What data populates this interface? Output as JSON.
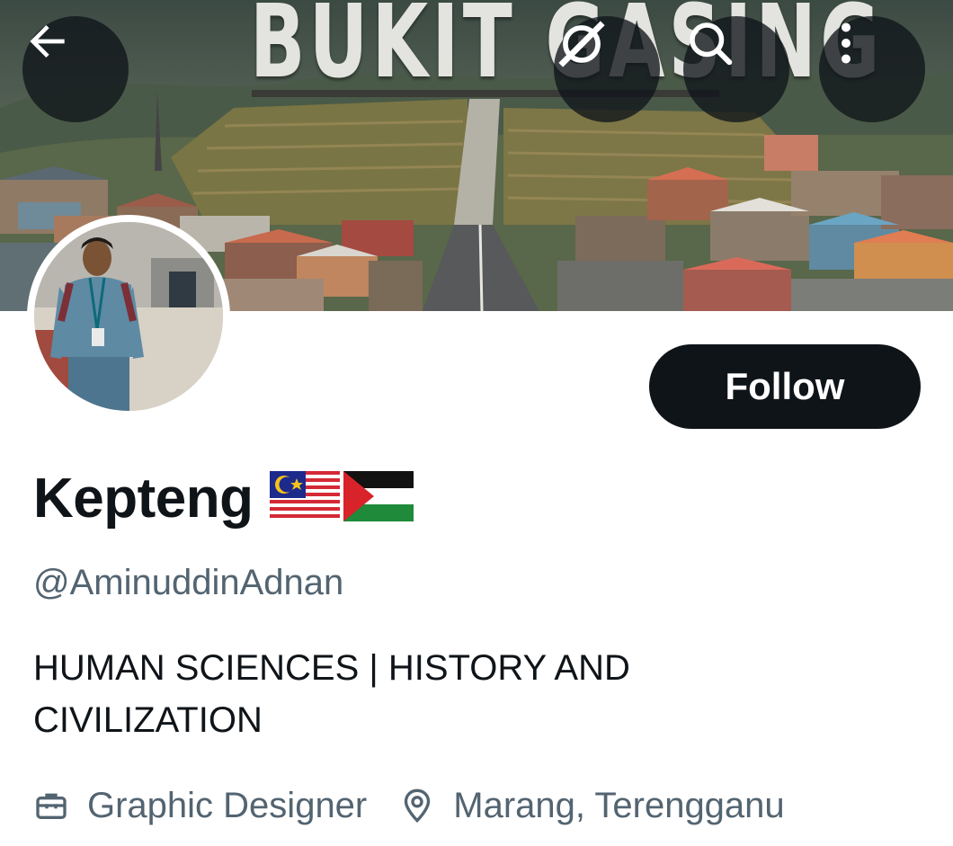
{
  "header": {
    "banner_text": "BUKIT GASING",
    "back_icon": "arrow-left-icon",
    "grok_icon": "grok-icon",
    "search_icon": "search-icon",
    "more_icon": "more-vertical-icon"
  },
  "profile": {
    "display_name": "Kepteng",
    "flags": [
      "malaysia-flag-emoji",
      "palestine-flag-emoji"
    ],
    "handle": "@AminuddinAdnan",
    "bio_line1": "HUMAN SCIENCES | HISTORY AND",
    "bio_line2": "CIVILIZATION",
    "profession_icon": "briefcase-icon",
    "profession": "Graphic Designer",
    "location_icon": "location-pin-icon",
    "location": "Marang, Terengganu"
  },
  "actions": {
    "follow_label": "Follow"
  },
  "colors": {
    "primary_text": "#0f1419",
    "secondary_text": "#536471",
    "button_bg": "#0f1419",
    "button_text": "#ffffff"
  }
}
